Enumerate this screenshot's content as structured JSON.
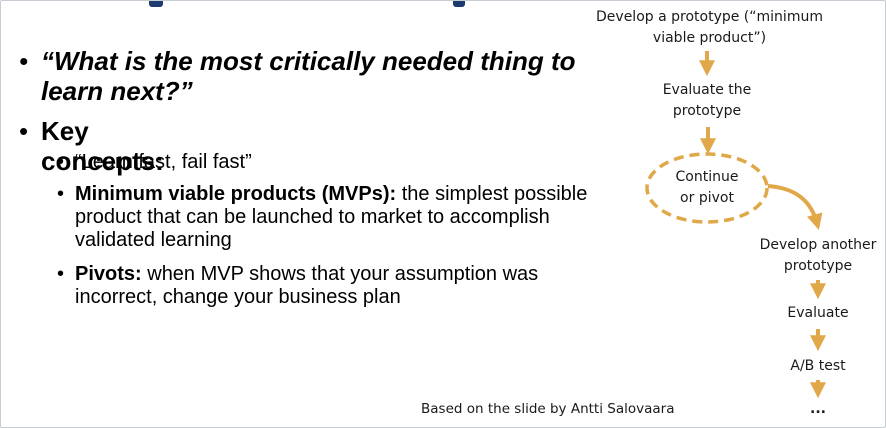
{
  "bullets": {
    "quote": "“What is the most critically needed thing to learn next?”",
    "key_concepts": "Key concepts:",
    "sub": [
      {
        "bold": "",
        "text": "“Learn fast, fail fast”"
      },
      {
        "bold": "Minimum viable products (MVPs):",
        "text": " the simplest possible product that can be launched to market to accomplish validated learning"
      },
      {
        "bold": "Pivots:",
        "text": " when MVP shows that your assumption was incorrect, change your business plan"
      }
    ],
    "bullet_glyph": "•"
  },
  "flow": {
    "step1_line1": "Develop a prototype (“minimum",
    "step1_line2": "viable product”)",
    "step2_line1": "Evaluate the",
    "step2_line2": "prototype",
    "decision_line1": "Continue",
    "decision_line2": "or pivot",
    "step4_line1": "Develop another",
    "step4_line2": "prototype",
    "step5": "Evaluate",
    "step6": "A/B test",
    "step7": "..."
  },
  "credit": "Based on the slide by Antti Salovaara",
  "colors": {
    "accent": "#e0a848",
    "title_bar": "#1e3b70",
    "text": "#000000"
  }
}
